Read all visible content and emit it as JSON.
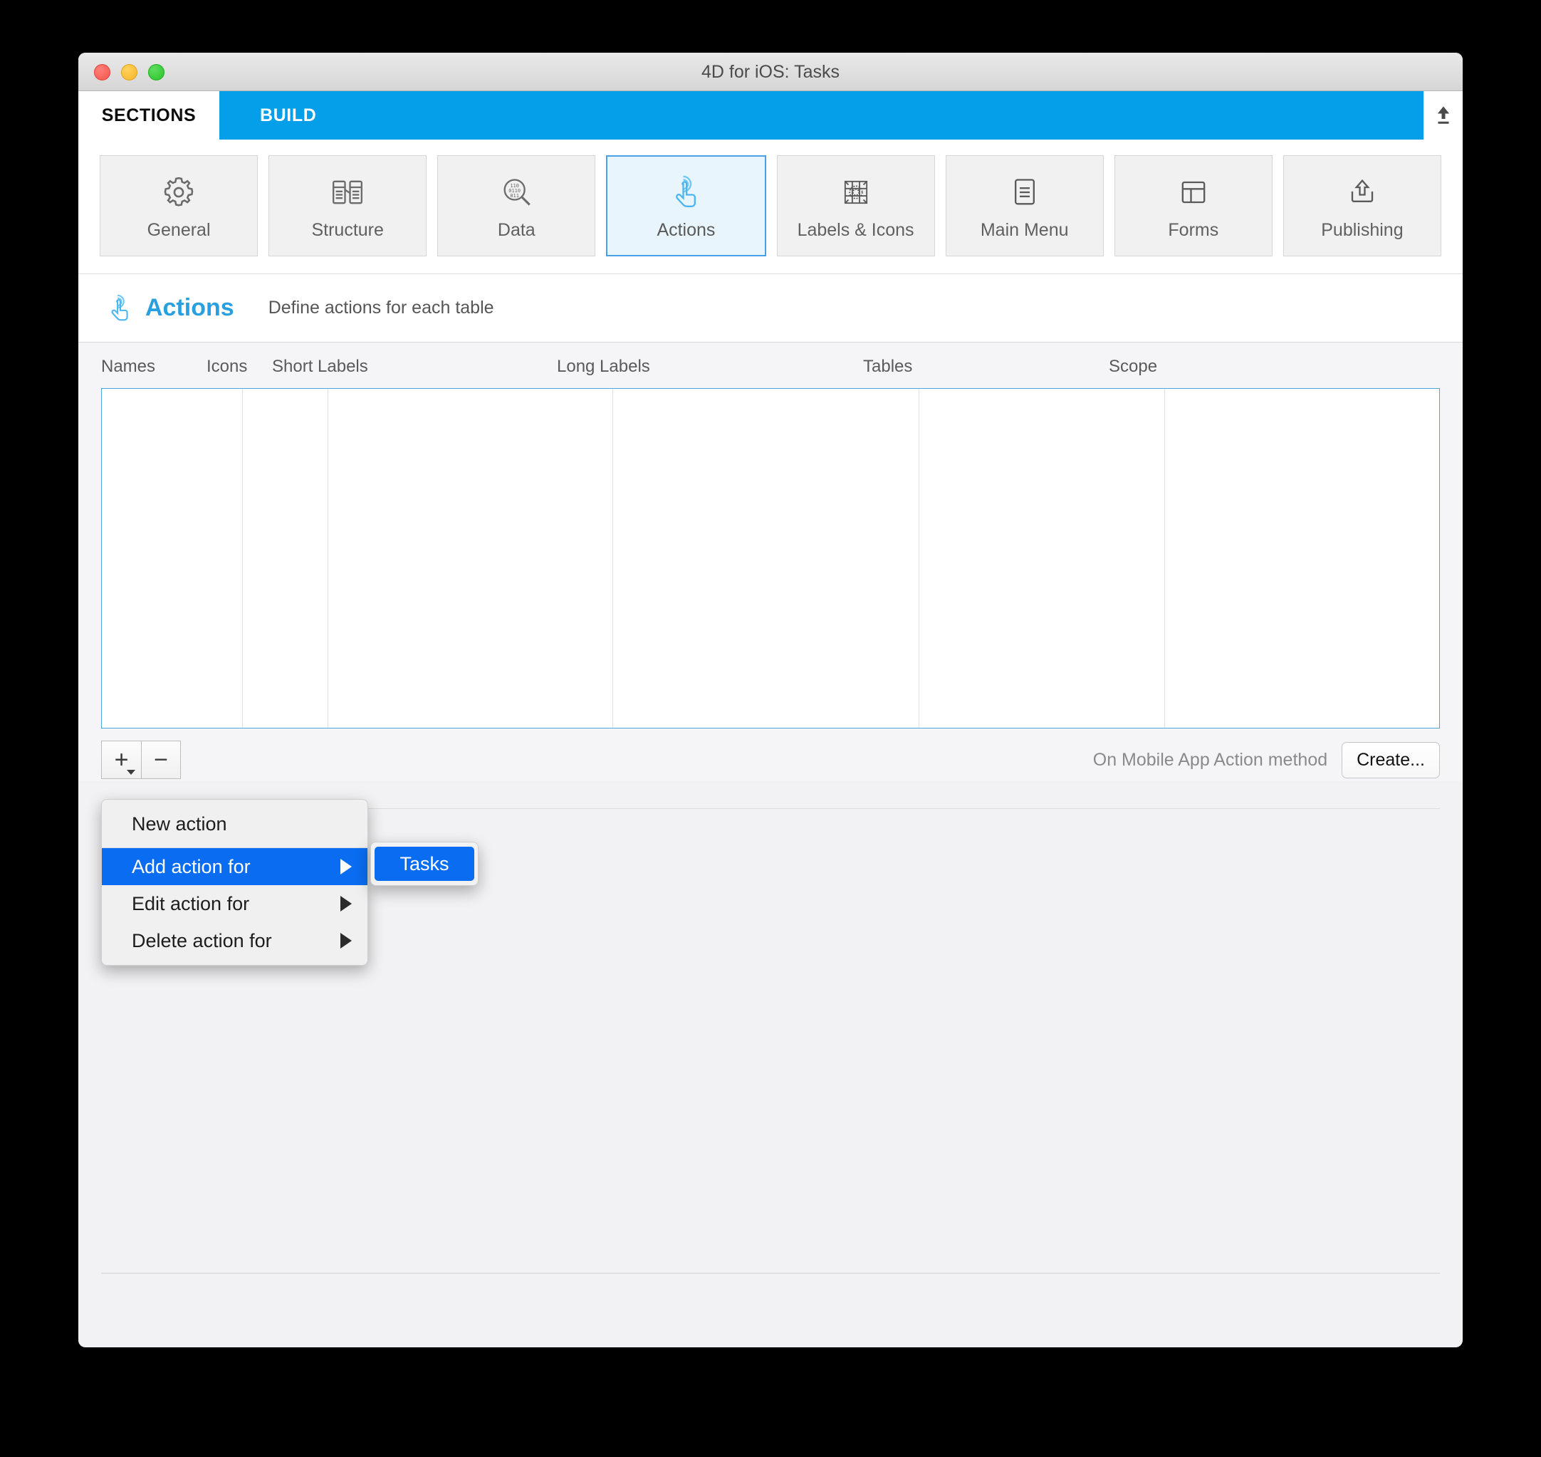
{
  "window": {
    "title": "4D for iOS: Tasks",
    "traffic_lights": [
      "close-button",
      "minimize-button",
      "zoom-button"
    ]
  },
  "tabs": {
    "active": "SECTIONS",
    "inactive": "BUILD",
    "upload_icon": "upload-icon"
  },
  "sections": [
    {
      "label": "General",
      "icon": "gear-icon",
      "selected": false
    },
    {
      "label": "Structure",
      "icon": "structure-icon",
      "selected": false
    },
    {
      "label": "Data",
      "icon": "data-search-icon",
      "selected": false
    },
    {
      "label": "Actions",
      "icon": "touch-icon",
      "selected": true
    },
    {
      "label": "Labels & Icons",
      "icon": "grid-art-icon",
      "selected": false
    },
    {
      "label": "Main Menu",
      "icon": "menu-doc-icon",
      "selected": false
    },
    {
      "label": "Forms",
      "icon": "layout-icon",
      "selected": false
    },
    {
      "label": "Publishing",
      "icon": "publish-icon",
      "selected": false
    }
  ],
  "page": {
    "icon": "touch-icon",
    "title": "Actions",
    "subtitle": "Define actions for each table"
  },
  "table": {
    "columns": [
      "Names",
      "Icons",
      "Short Labels",
      "Long Labels",
      "Tables",
      "Scope"
    ],
    "rows": []
  },
  "toolbar": {
    "add_label": "+",
    "remove_label": "−",
    "method_label": "On Mobile App Action method",
    "create_label": "Create..."
  },
  "context_menu": {
    "items": [
      {
        "label": "New action",
        "has_submenu": false,
        "highlighted": false
      },
      {
        "label": "Add action for",
        "has_submenu": true,
        "highlighted": true
      },
      {
        "label": "Edit action for",
        "has_submenu": true,
        "highlighted": false
      },
      {
        "label": "Delete action for",
        "has_submenu": true,
        "highlighted": false
      }
    ],
    "submenu": {
      "items": [
        {
          "label": "Tasks",
          "highlighted": true
        }
      ]
    }
  },
  "colors": {
    "accent_blue": "#049fe8",
    "title_blue": "#2a9fe0",
    "selection_blue": "#0a6cf0",
    "tile_selected_bg": "#e8f5fd",
    "tile_selected_border": "#4a9fe8",
    "grid_border": "#4aa8de"
  }
}
